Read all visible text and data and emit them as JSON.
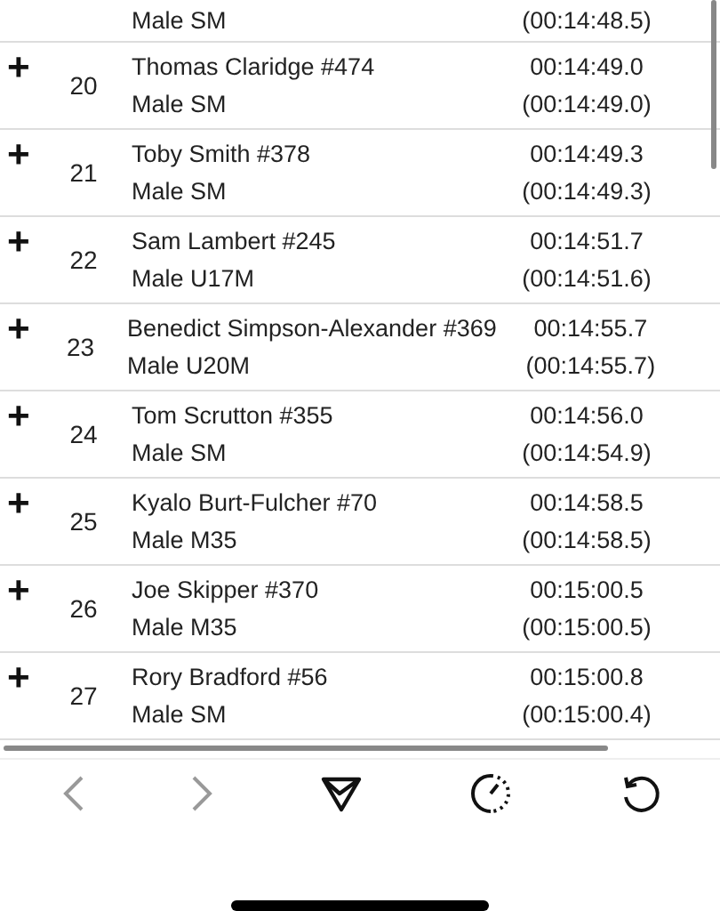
{
  "partial_row": {
    "category": "Male SM",
    "chip_time": "(00:14:48.5)"
  },
  "rows": [
    {
      "expand": "+",
      "rank": "20",
      "name": "Thomas Claridge #474",
      "category": "Male SM",
      "gun_time": "00:14:49.0",
      "chip_time": "(00:14:49.0)"
    },
    {
      "expand": "+",
      "rank": "21",
      "name": "Toby Smith #378",
      "category": "Male SM",
      "gun_time": "00:14:49.3",
      "chip_time": "(00:14:49.3)"
    },
    {
      "expand": "+",
      "rank": "22",
      "name": "Sam Lambert #245",
      "category": "Male U17M",
      "gun_time": "00:14:51.7",
      "chip_time": "(00:14:51.6)"
    },
    {
      "expand": "+",
      "rank": "23",
      "name": "Benedict Simpson-Alexander #369",
      "category": "Male U20M",
      "gun_time": "00:14:55.7",
      "chip_time": "(00:14:55.7)"
    },
    {
      "expand": "+",
      "rank": "24",
      "name": "Tom Scrutton #355",
      "category": "Male SM",
      "gun_time": "00:14:56.0",
      "chip_time": "(00:14:54.9)"
    },
    {
      "expand": "+",
      "rank": "25",
      "name": "Kyalo Burt-Fulcher #70",
      "category": "Male M35",
      "gun_time": "00:14:58.5",
      "chip_time": "(00:14:58.5)"
    },
    {
      "expand": "+",
      "rank": "26",
      "name": "Joe Skipper #370",
      "category": "Male M35",
      "gun_time": "00:15:00.5",
      "chip_time": "(00:15:00.5)"
    },
    {
      "expand": "+",
      "rank": "27",
      "name": "Rory Bradford #56",
      "category": "Male SM",
      "gun_time": "00:15:00.8",
      "chip_time": "(00:15:00.4)"
    }
  ],
  "toolbar": [
    {
      "kind": "back",
      "disabled": true
    },
    {
      "kind": "forward",
      "disabled": true
    },
    {
      "kind": "share",
      "disabled": false
    },
    {
      "kind": "timer",
      "disabled": false
    },
    {
      "kind": "reload",
      "disabled": false
    }
  ]
}
